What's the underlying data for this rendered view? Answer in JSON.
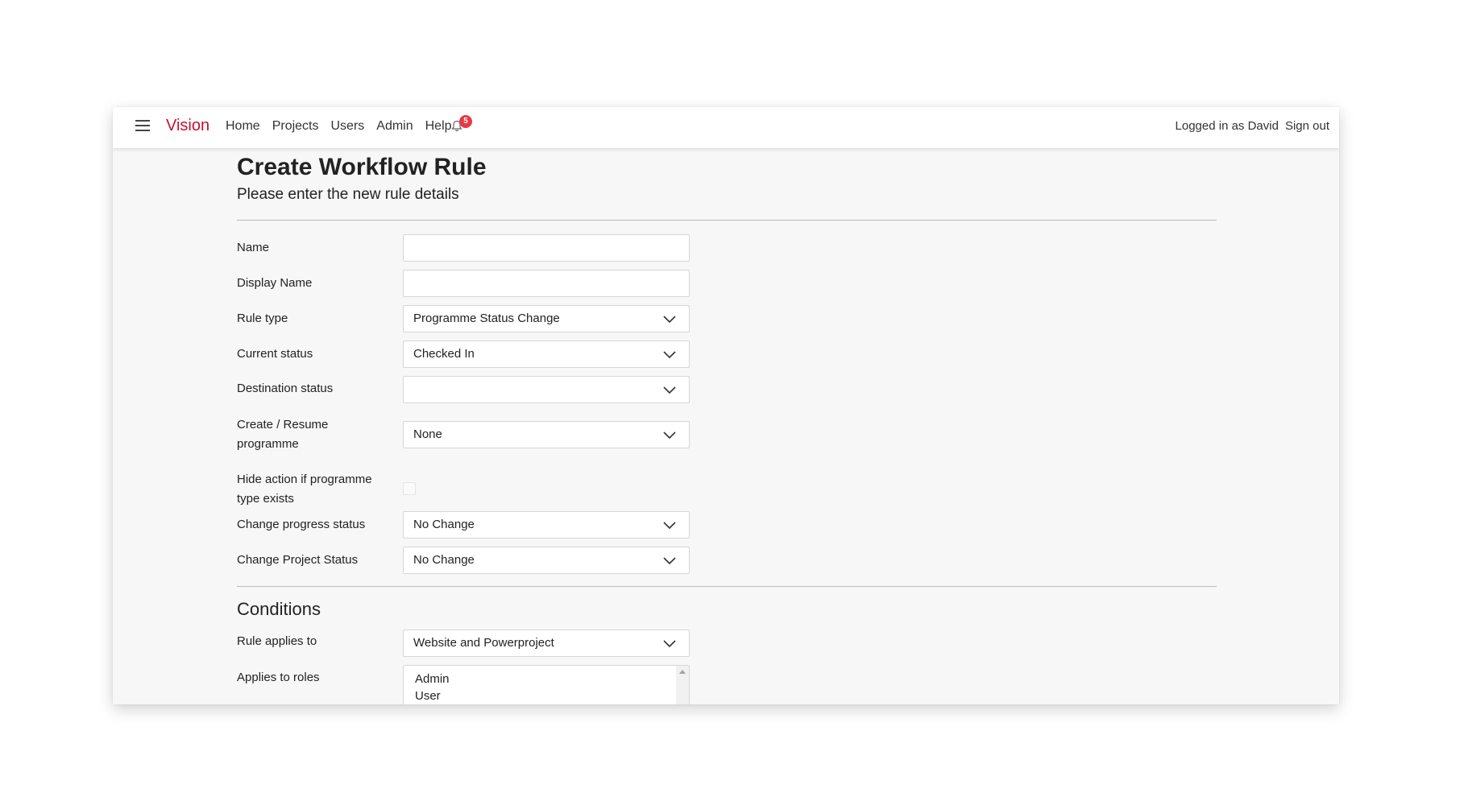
{
  "nav": {
    "brand": "Vision",
    "links": [
      "Home",
      "Projects",
      "Users",
      "Admin",
      "Help"
    ],
    "notification_count": "5",
    "logged_in_text": "Logged in as David",
    "sign_out": "Sign out"
  },
  "page": {
    "title": "Create Workflow Rule",
    "subtitle": "Please enter the new rule details"
  },
  "form": {
    "name": {
      "label": "Name",
      "value": ""
    },
    "display_name": {
      "label": "Display Name",
      "value": ""
    },
    "rule_type": {
      "label": "Rule type",
      "value": "Programme Status Change"
    },
    "current_status": {
      "label": "Current status",
      "value": "Checked In"
    },
    "destination_status": {
      "label": "Destination status",
      "value": ""
    },
    "create_resume": {
      "label_line1": "Create / Resume",
      "label_line2": "programme",
      "value": "None"
    },
    "hide_action": {
      "label_line1": "Hide action if programme",
      "label_line2": "type exists",
      "checked": false
    },
    "change_progress_status": {
      "label": "Change progress status",
      "value": "No Change"
    },
    "change_project_status": {
      "label": "Change Project Status",
      "value": "No Change"
    }
  },
  "conditions": {
    "title": "Conditions",
    "rule_applies_to": {
      "label": "Rule applies to",
      "value": "Website and Powerproject"
    },
    "applies_to_roles": {
      "label": "Applies to roles",
      "options": [
        "Admin",
        "User"
      ]
    }
  },
  "icons": {
    "menu": "hamburger-menu-icon",
    "notifications": "bell-icon",
    "dropdown": "chevron-down-icon"
  },
  "colors": {
    "brand": "#c8102e",
    "badge": "#e53945",
    "page_bg": "#f7f7f7"
  }
}
